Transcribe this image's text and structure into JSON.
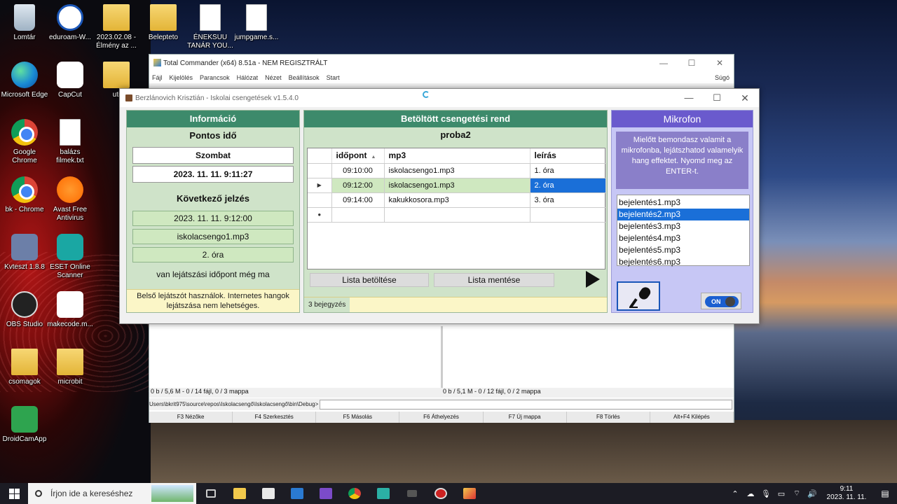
{
  "desktop": {
    "icons": [
      {
        "label": "Lomtár"
      },
      {
        "label": "eduroam-W..."
      },
      {
        "label": "2023.02.08 - Élmény az ..."
      },
      {
        "label": "Belepteto"
      },
      {
        "label": "ÉNEKSUU TANÁR YOU..."
      },
      {
        "label": "jumpgame.s..."
      },
      {
        "label": "Microsoft Edge"
      },
      {
        "label": "CapCut"
      },
      {
        "label": "uti"
      },
      {
        "label": "Google Chrome"
      },
      {
        "label": "balázs filmek.txt"
      },
      {
        "label": "bk - Chrome"
      },
      {
        "label": "Avast Free Antivirus"
      },
      {
        "label": "Kvteszt 1.8.8"
      },
      {
        "label": "ESET Online Scanner"
      },
      {
        "label": "OBS Studio"
      },
      {
        "label": "makecode.m..."
      },
      {
        "label": "csomagok"
      },
      {
        "label": "microbit"
      },
      {
        "label": "DroidCamApp"
      }
    ]
  },
  "total_commander": {
    "title": "Total Commander (x64) 8.51a - NEM REGISZTRÁLT",
    "menu": [
      "Fájl",
      "Kijelölés",
      "Parancsok",
      "Hálózat",
      "Nézet",
      "Beállítások",
      "Start"
    ],
    "help": "Súgó",
    "status_left": "0 b / 5,6 M - 0 / 14 fájl, 0 / 3 mappa",
    "status_right": "0 b / 5,1 M - 0 / 12 fájl, 0 / 2 mappa",
    "path": "Users\\bkrit975\\source\\repos\\Iskolacsengő\\Iskolacsengő\\bin\\Debug>",
    "fkeys": [
      "F3 Nézőke",
      "F4 Szerkesztés",
      "F5 Másolás",
      "F6 Áthelyezés",
      "F7 Új mappa",
      "F8 Törlés",
      "Alt+F4 Kilépés"
    ]
  },
  "app": {
    "title": "Berzlánovich Krisztián - Iskolai csengetések v1.5.4.0",
    "controls": {
      "minimize": "—",
      "maximize": "☐",
      "close": "✕"
    },
    "info": {
      "header": "Információ",
      "exact_time_label": "Pontos idő",
      "day": "Szombat",
      "datetime": "2023. 11. 11. 9:11:27",
      "next_label": "Következő jelzés",
      "next_datetime": "2023. 11. 11. 9:12:00",
      "next_file": "iskolacsengo1.mp3",
      "next_desc": "2. óra",
      "remaining_note": "van lejátszási időpont még ma",
      "warning": "Belső lejátszót használok. Internetes hangok lejátszása nem lehetséges."
    },
    "schedule": {
      "header": "Betöltött csengetési rend",
      "name": "proba2",
      "columns": {
        "time": "időpont",
        "mp3": "mp3",
        "desc": "leírás"
      },
      "rows": [
        {
          "time": "09:10:00",
          "mp3": "iskolacsengo1.mp3",
          "desc": "1. óra"
        },
        {
          "time": "09:12:00",
          "mp3": "iskolacsengo1.mp3",
          "desc": "2. óra"
        },
        {
          "time": "09:14:00",
          "mp3": "kakukkosora.mp3",
          "desc": "3. óra"
        }
      ],
      "load_button": "Lista betöltése",
      "save_button": "Lista mentése",
      "count": "3 bejegyzés"
    },
    "mic": {
      "header": "Mikrofon",
      "info": "Mielőtt bemondasz valamit a mikrofonba, lejátszhatod valamelyik hang effektet. Nyomd meg az ENTER-t.",
      "items": [
        "bejelentés1.mp3",
        "bejelentés2.mp3",
        "bejelentés3.mp3",
        "bejelentés4.mp3",
        "bejelentés5.mp3",
        "bejelentés6.mp3"
      ],
      "toggle_label": "ON"
    }
  },
  "taskbar": {
    "search_placeholder": "Írjon ide a kereséshez",
    "time": "9:11",
    "date": "2023. 11. 11."
  }
}
